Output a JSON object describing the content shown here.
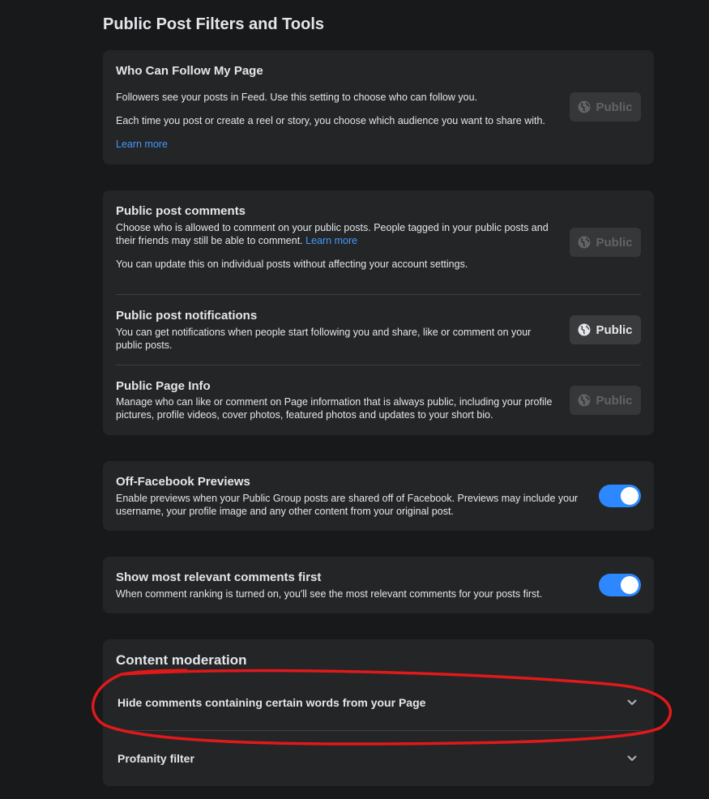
{
  "page": {
    "title": "Public Post Filters and Tools"
  },
  "follow": {
    "title": "Who Can Follow My Page",
    "line1": "Followers see your posts in Feed. Use this setting to choose who can follow you.",
    "line2": "Each time you post or create a reel or story, you choose which audience you want to share with.",
    "learn_more": "Learn more",
    "button": "Public"
  },
  "comments": {
    "title": "Public post comments",
    "desc": "Choose who is allowed to comment on your public posts. People tagged in your public posts and their friends may still be able to comment.",
    "learn_more": "Learn more",
    "note": "You can update this on individual posts without affecting your account settings.",
    "button": "Public"
  },
  "notifications": {
    "title": "Public post notifications",
    "desc": "You can get notifications when people start following you and share, like or comment on your public posts.",
    "button": "Public"
  },
  "page_info": {
    "title": "Public Page Info",
    "desc": "Manage who can like or comment on Page information that is always public, including your profile pictures, profile videos, cover photos, featured photos and updates to your short bio.",
    "button": "Public"
  },
  "previews": {
    "title": "Off-Facebook Previews",
    "desc": "Enable previews when your Public Group posts are shared off of Facebook. Previews may include your username, your profile image and any other content from your original post.",
    "enabled": true
  },
  "relevant": {
    "title": "Show most relevant comments first",
    "desc": "When comment ranking is turned on, you'll see the most relevant comments for your posts first.",
    "enabled": true
  },
  "moderation": {
    "title": "Content moderation",
    "items": [
      {
        "label": "Hide comments containing certain words from your Page",
        "icon": "chevron-down-icon"
      },
      {
        "label": "Profanity filter",
        "icon": "chevron-down-icon"
      }
    ]
  },
  "colors": {
    "accent": "#2d88ff",
    "link": "#4599ff",
    "annotation": "#e0191b"
  }
}
